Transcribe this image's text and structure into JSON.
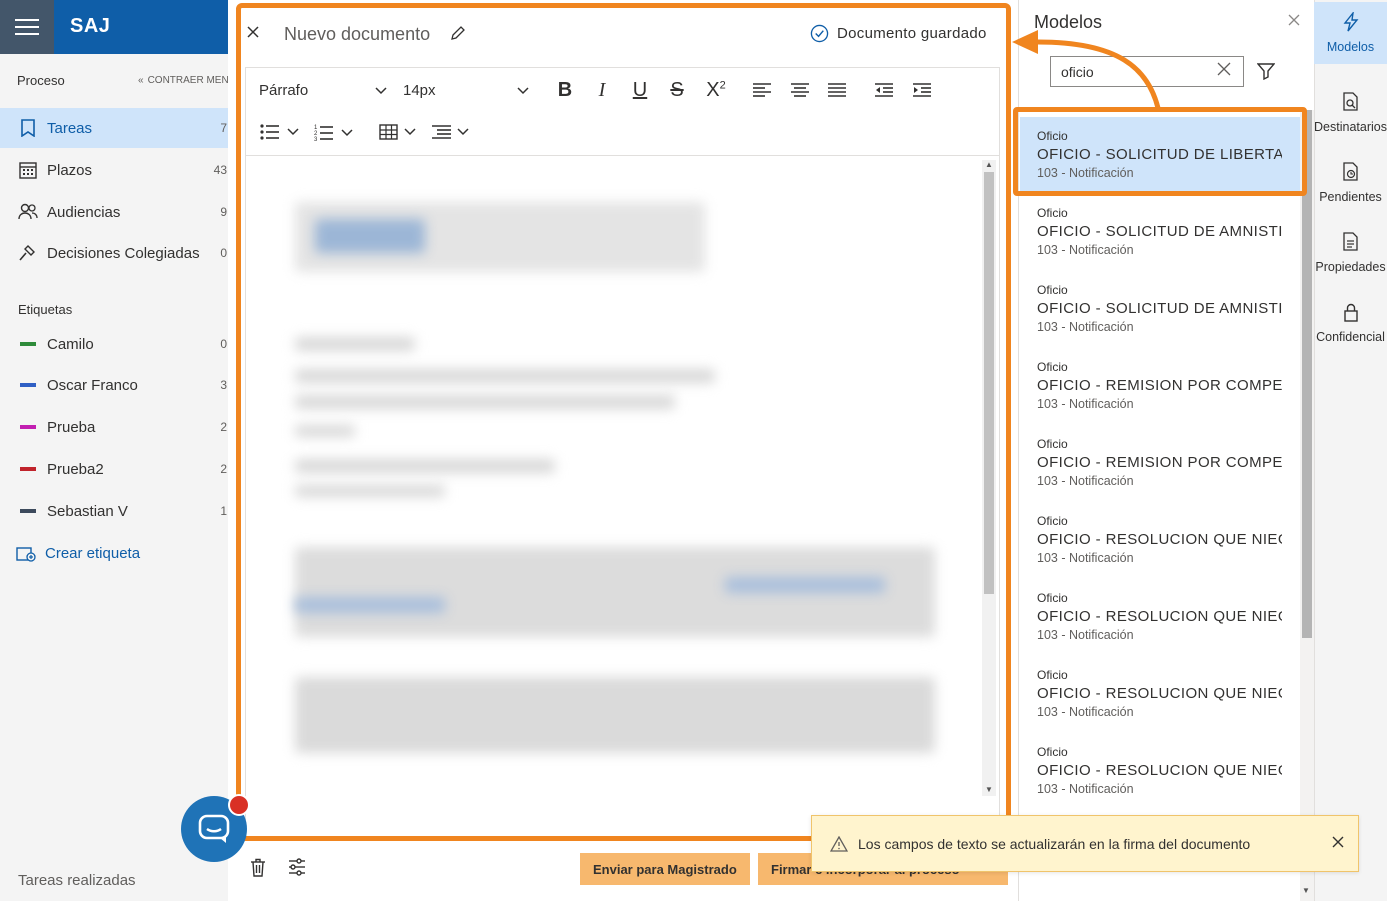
{
  "app": {
    "brand": "SAJ"
  },
  "sidebar": {
    "section_process": "Proceso",
    "collapse_label": "CONTRAER MENÚ",
    "nav": [
      {
        "label": "Tareas",
        "count": "7",
        "icon": "bookmark-icon"
      },
      {
        "label": "Plazos",
        "count": "43",
        "icon": "calendar-icon"
      },
      {
        "label": "Audiencias",
        "count": "9",
        "icon": "people-icon"
      },
      {
        "label": "Decisiones Colegiadas",
        "count": "0",
        "icon": "gavel-icon"
      }
    ],
    "section_tags": "Etiquetas",
    "tags": [
      {
        "label": "Camilo",
        "count": "0",
        "color": "#2e8b3a"
      },
      {
        "label": "Oscar Franco",
        "count": "3",
        "color": "#2f5fc4"
      },
      {
        "label": "Prueba",
        "count": "2",
        "color": "#c21fb1"
      },
      {
        "label": "Prueba2",
        "count": "2",
        "color": "#c0232b"
      },
      {
        "label": "Sebastian V",
        "count": "1",
        "color": "#3c4a5c"
      }
    ],
    "create_tag": "Crear etiqueta",
    "done_tasks": "Tareas realizadas"
  },
  "editor": {
    "title": "Nuevo documento",
    "saved_status": "Documento guardado",
    "paragraph_style": "Párrafo",
    "font_size": "14px",
    "send_button": "Enviar para Magistrado",
    "sign_button": "Firmar e incorporar al proceso"
  },
  "toast": {
    "message": "Los campos de texto se actualizarán en la firma del documento"
  },
  "models": {
    "title": "Modelos",
    "search_value": "oficio",
    "items": [
      {
        "type": "Oficio",
        "name": "OFICIO - SOLICITUD DE LIBERTAD C",
        "sub": "103 - Notificación"
      },
      {
        "type": "Oficio",
        "name": "OFICIO - SOLICITUD DE AMNISTIA",
        "sub": "103 - Notificación"
      },
      {
        "type": "Oficio",
        "name": "OFICIO - SOLICITUD DE AMNISTIA",
        "sub": "103 - Notificación"
      },
      {
        "type": "Oficio",
        "name": "OFICIO - REMISION POR COMPETE",
        "sub": "103 - Notificación"
      },
      {
        "type": "Oficio",
        "name": "OFICIO - REMISION POR COMPETE",
        "sub": "103 - Notificación"
      },
      {
        "type": "Oficio",
        "name": "OFICIO - RESOLUCION QUE NIEGA",
        "sub": "103 - Notificación"
      },
      {
        "type": "Oficio",
        "name": "OFICIO - RESOLUCION QUE NIEGA",
        "sub": "103 - Notificación"
      },
      {
        "type": "Oficio",
        "name": "OFICIO - RESOLUCION QUE NIEGA",
        "sub": "103 - Notificación"
      },
      {
        "type": "Oficio",
        "name": "OFICIO - RESOLUCION QUE NIEGA",
        "sub": "103 - Notificación"
      }
    ]
  },
  "rail": [
    {
      "label": "Modelos",
      "icon": "lightning-icon"
    },
    {
      "label": "Destinatarios",
      "icon": "document-search-icon"
    },
    {
      "label": "Pendientes",
      "icon": "document-clock-icon"
    },
    {
      "label": "Propiedades",
      "icon": "document-properties-icon"
    },
    {
      "label": "Confidencial",
      "icon": "lock-icon"
    }
  ],
  "colors": {
    "brand": "#0f5ea8",
    "highlight": "#f0851f",
    "selected": "#cfe4fa",
    "button": "#f7b86e"
  }
}
